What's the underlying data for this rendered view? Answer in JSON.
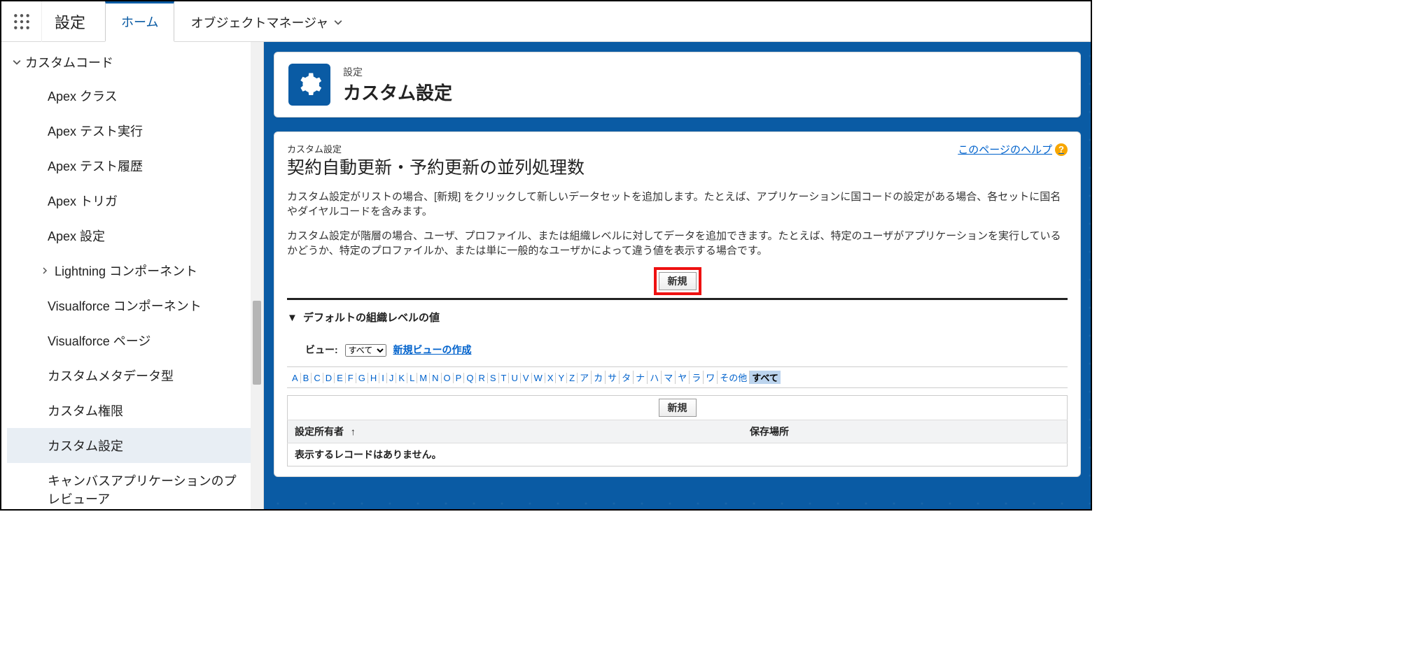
{
  "topbar": {
    "app_name": "設定",
    "tabs": [
      {
        "label": "ホーム",
        "active": true,
        "name": "tab-home",
        "has_menu": false
      },
      {
        "label": "オブジェクトマネージャ",
        "active": false,
        "name": "tab-object-manager",
        "has_menu": true
      }
    ]
  },
  "sidebar": {
    "group_label": "カスタムコード",
    "items": [
      {
        "label": "Apex クラス",
        "name": "sidebar-item-apex-class",
        "type": "leaf"
      },
      {
        "label": "Apex テスト実行",
        "name": "sidebar-item-apex-test-run",
        "type": "leaf"
      },
      {
        "label": "Apex テスト履歴",
        "name": "sidebar-item-apex-test-history",
        "type": "leaf"
      },
      {
        "label": "Apex トリガ",
        "name": "sidebar-item-apex-trigger",
        "type": "leaf"
      },
      {
        "label": "Apex 設定",
        "name": "sidebar-item-apex-settings",
        "type": "leaf"
      },
      {
        "label": "Lightning コンポーネント",
        "name": "sidebar-item-lightning-components",
        "type": "group"
      },
      {
        "label": "Visualforce コンポーネント",
        "name": "sidebar-item-vf-components",
        "type": "leaf"
      },
      {
        "label": "Visualforce ページ",
        "name": "sidebar-item-vf-pages",
        "type": "leaf"
      },
      {
        "label": "カスタムメタデータ型",
        "name": "sidebar-item-custom-metadata",
        "type": "leaf"
      },
      {
        "label": "カスタム権限",
        "name": "sidebar-item-custom-permissions",
        "type": "leaf"
      },
      {
        "label": "カスタム設定",
        "name": "sidebar-item-custom-settings",
        "type": "leaf",
        "active": true
      },
      {
        "label": "キャンバスアプリケーションのプレビューア",
        "name": "sidebar-item-canvas-previewer",
        "type": "leaf"
      }
    ]
  },
  "page_header": {
    "eyebrow": "設定",
    "title": "カスタム設定"
  },
  "body": {
    "section_eyebrow": "カスタム設定",
    "section_title": "契約自動更新・予約更新の並列処理数",
    "help_link": "このページのヘルプ",
    "desc1": "カスタム設定がリストの場合、[新規] をクリックして新しいデータセットを追加します。たとえば、アプリケーションに国コードの設定がある場合、各セットに国名やダイヤルコードを含みます。",
    "desc2": "カスタム設定が階層の場合、ユーザ、プロファイル、または組織レベルに対してデータを追加できます。たとえば、特定のユーザがアプリケーションを実行しているかどうか、特定のプロファイルか、または単に一般的なユーザかによって違う値を表示する場合です。",
    "new_button": "新規",
    "collapser": "デフォルトの組織レベルの値",
    "view_label": "ビュー:",
    "view_selected": "すべて",
    "create_view_link": "新規ビューの作成",
    "alphabet": [
      "A",
      "B",
      "C",
      "D",
      "E",
      "F",
      "G",
      "H",
      "I",
      "J",
      "K",
      "L",
      "M",
      "N",
      "O",
      "P",
      "Q",
      "R",
      "S",
      "T",
      "U",
      "V",
      "W",
      "X",
      "Y",
      "Z",
      "ア",
      "カ",
      "サ",
      "タ",
      "ナ",
      "ハ",
      "マ",
      "ヤ",
      "ラ",
      "ワ",
      "その他",
      "すべて"
    ],
    "alphabet_active": "すべて",
    "table": {
      "new_button": "新規",
      "col_owner": "設定所有者",
      "col_location": "保存場所",
      "empty_msg": "表示するレコードはありません。"
    }
  }
}
